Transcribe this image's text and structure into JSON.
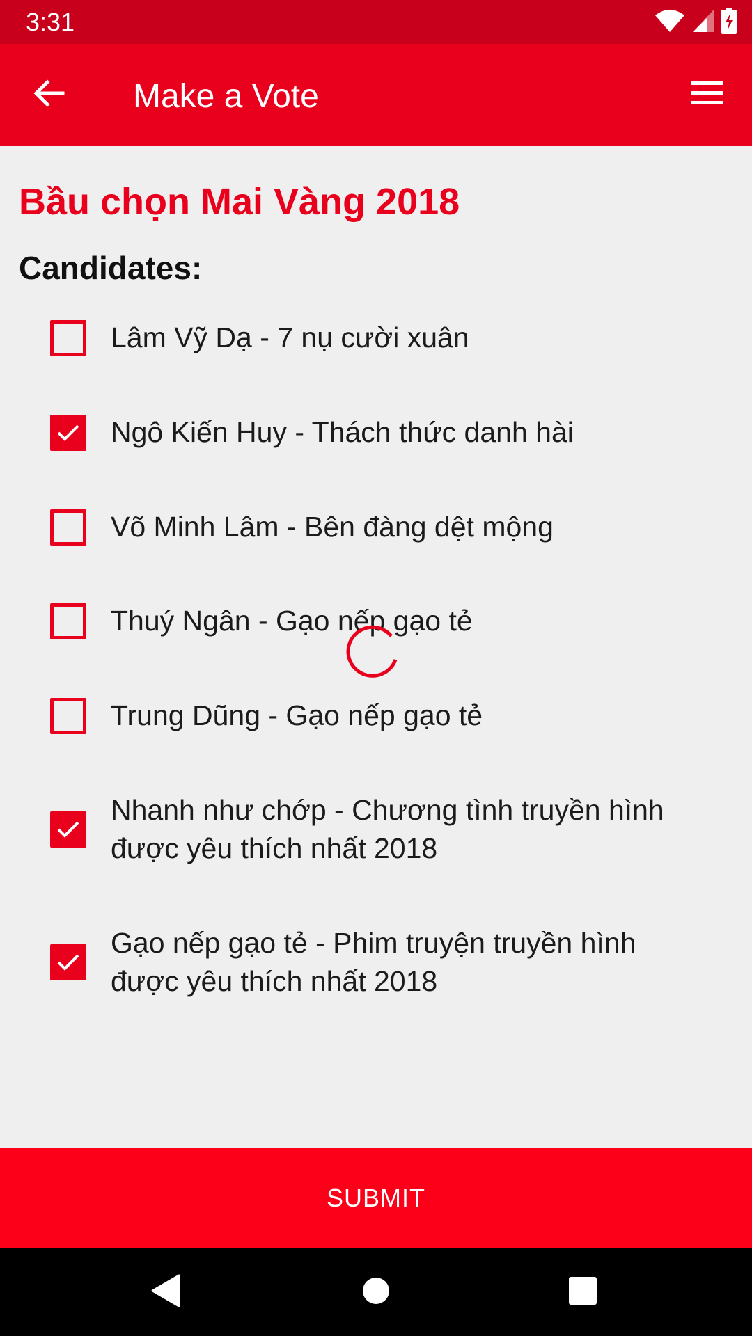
{
  "status_bar": {
    "time": "3:31",
    "icons": [
      "wifi-icon",
      "signal-icon",
      "battery-charging-icon"
    ]
  },
  "app_bar": {
    "title": "Make a Vote",
    "back_icon": "arrow-back-icon",
    "menu_icon": "hamburger-menu-icon"
  },
  "content": {
    "heading": "Bầu chọn Mai Vàng 2018",
    "subheading": "Candidates:",
    "candidates": [
      {
        "label": "Lâm Vỹ Dạ - 7 nụ cười xuân",
        "checked": false
      },
      {
        "label": "Ngô Kiến Huy - Thách thức danh hài",
        "checked": true
      },
      {
        "label": "Võ Minh Lâm - Bên đàng dệt mộng",
        "checked": false
      },
      {
        "label": "Thuý Ngân - Gạo nếp gạo tẻ",
        "checked": false
      },
      {
        "label": "Trung Dũng - Gạo nếp gạo tẻ",
        "checked": false
      },
      {
        "label": "Nhanh như chớp - Chương tình truyền hình được yêu thích nhất 2018",
        "checked": true
      },
      {
        "label": "Gạo nếp gạo tẻ - Phim truyện truyền hình được yêu thích nhất 2018",
        "checked": true
      }
    ],
    "loading": true
  },
  "submit": {
    "label": "SUBMIT"
  },
  "nav_bar": {
    "back_icon": "nav-back-icon",
    "home_icon": "nav-home-icon",
    "recents_icon": "nav-recents-icon"
  },
  "colors": {
    "primary": "#e8001c",
    "status_bar": "#c9001b",
    "submit": "#fb0018",
    "background": "#efefef"
  }
}
